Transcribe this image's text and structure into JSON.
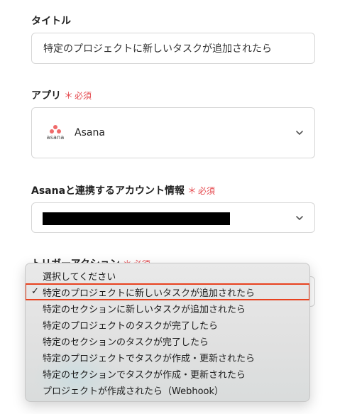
{
  "title_field": {
    "label": "タイトル",
    "value": "特定のプロジェクトに新しいタスクが追加されたら"
  },
  "app_field": {
    "label": "アプリ",
    "required_mark": "＊",
    "required_text": "必須",
    "logo_text": "asana",
    "value": "Asana",
    "brand_color": "#f06a6a"
  },
  "account_field": {
    "label": "Asanaと連携するアカウント情報",
    "required_mark": "＊",
    "required_text": "必須"
  },
  "trigger_field": {
    "label": "トリガーアクション",
    "required_mark": "＊",
    "required_text": "必須"
  },
  "dropdown": {
    "selected_index": 1,
    "highlight_color": "#e8411f",
    "check_glyph": "✓",
    "options": [
      "選択してください",
      "特定のプロジェクトに新しいタスクが追加されたら",
      "特定のセクションに新しいタスクが追加されたら",
      "特定のプロジェクトのタスクが完了したら",
      "特定のセクションのタスクが完了したら",
      "特定のプロジェクトでタスクが作成・更新されたら",
      "特定のセクションでタスクが作成・更新されたら",
      "プロジェクトが作成されたら（Webhook）"
    ]
  }
}
